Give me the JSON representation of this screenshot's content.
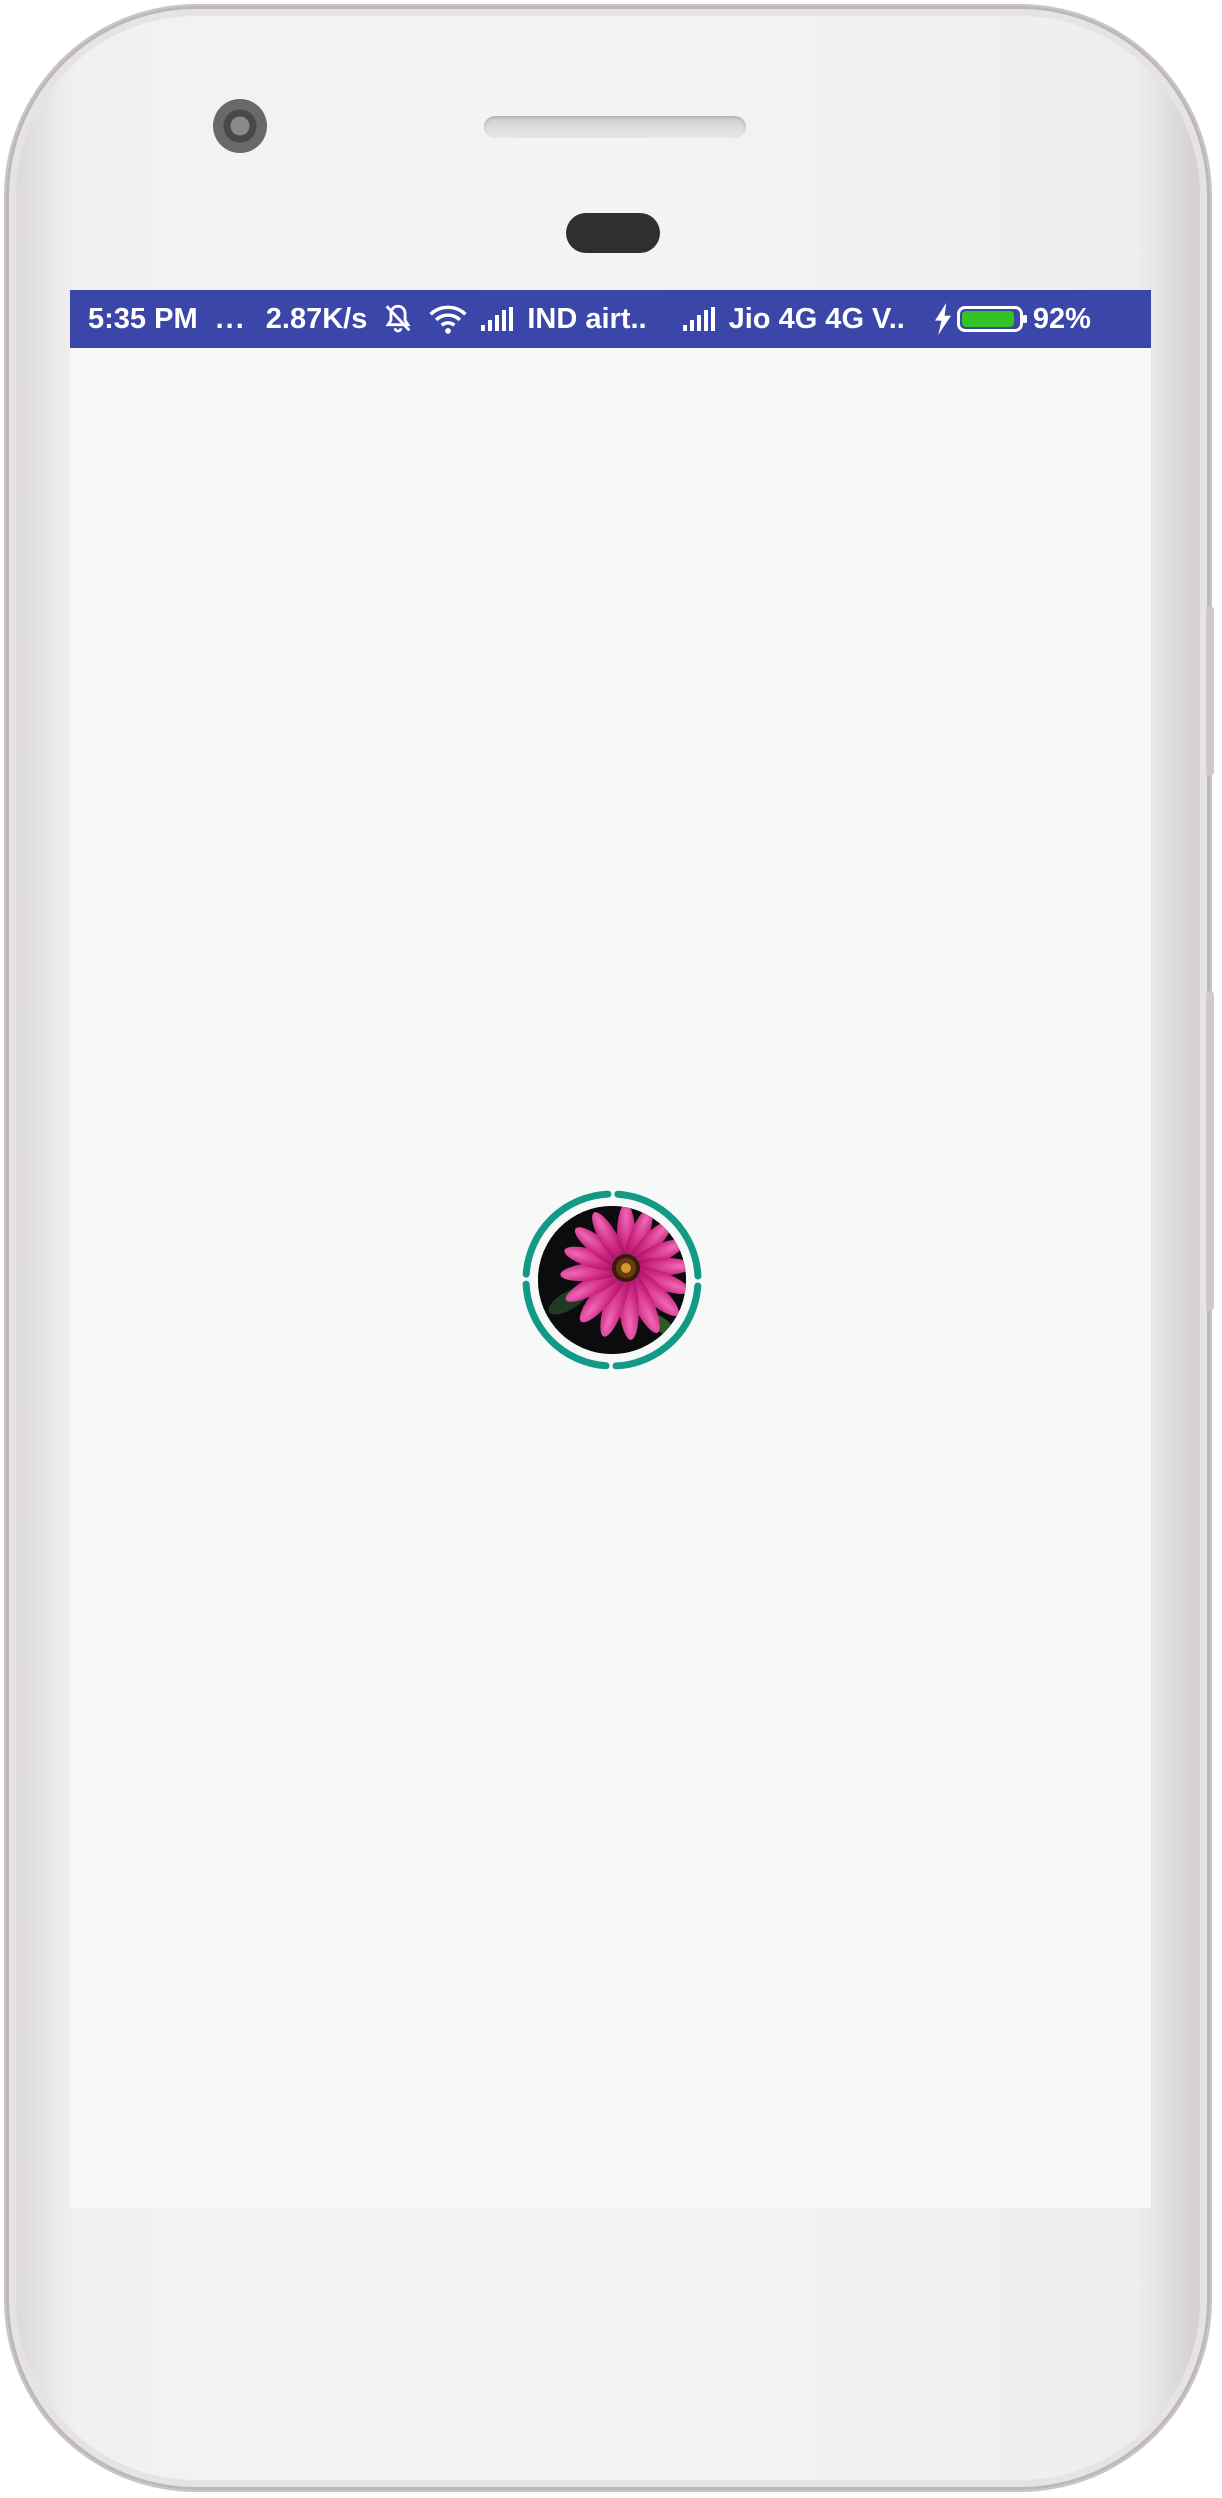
{
  "status_bar": {
    "time": "5:35 PM",
    "dots": "...",
    "network_speed": "2.87K/s",
    "carrier_1": "IND airt..",
    "carrier_2": "Jio 4G 4G V..",
    "battery_percent": "92%",
    "battery_level": 92,
    "background_color": "#3a47a8",
    "icons": [
      "muted-bell-icon",
      "wifi-icon",
      "signal-icon",
      "signal-icon",
      "charging-bolt-icon",
      "battery-icon"
    ]
  },
  "content": {
    "loader_ring_color": "#129a86",
    "avatar_image": "pink-daisy-flower",
    "background_color": "#f7f8f8"
  }
}
